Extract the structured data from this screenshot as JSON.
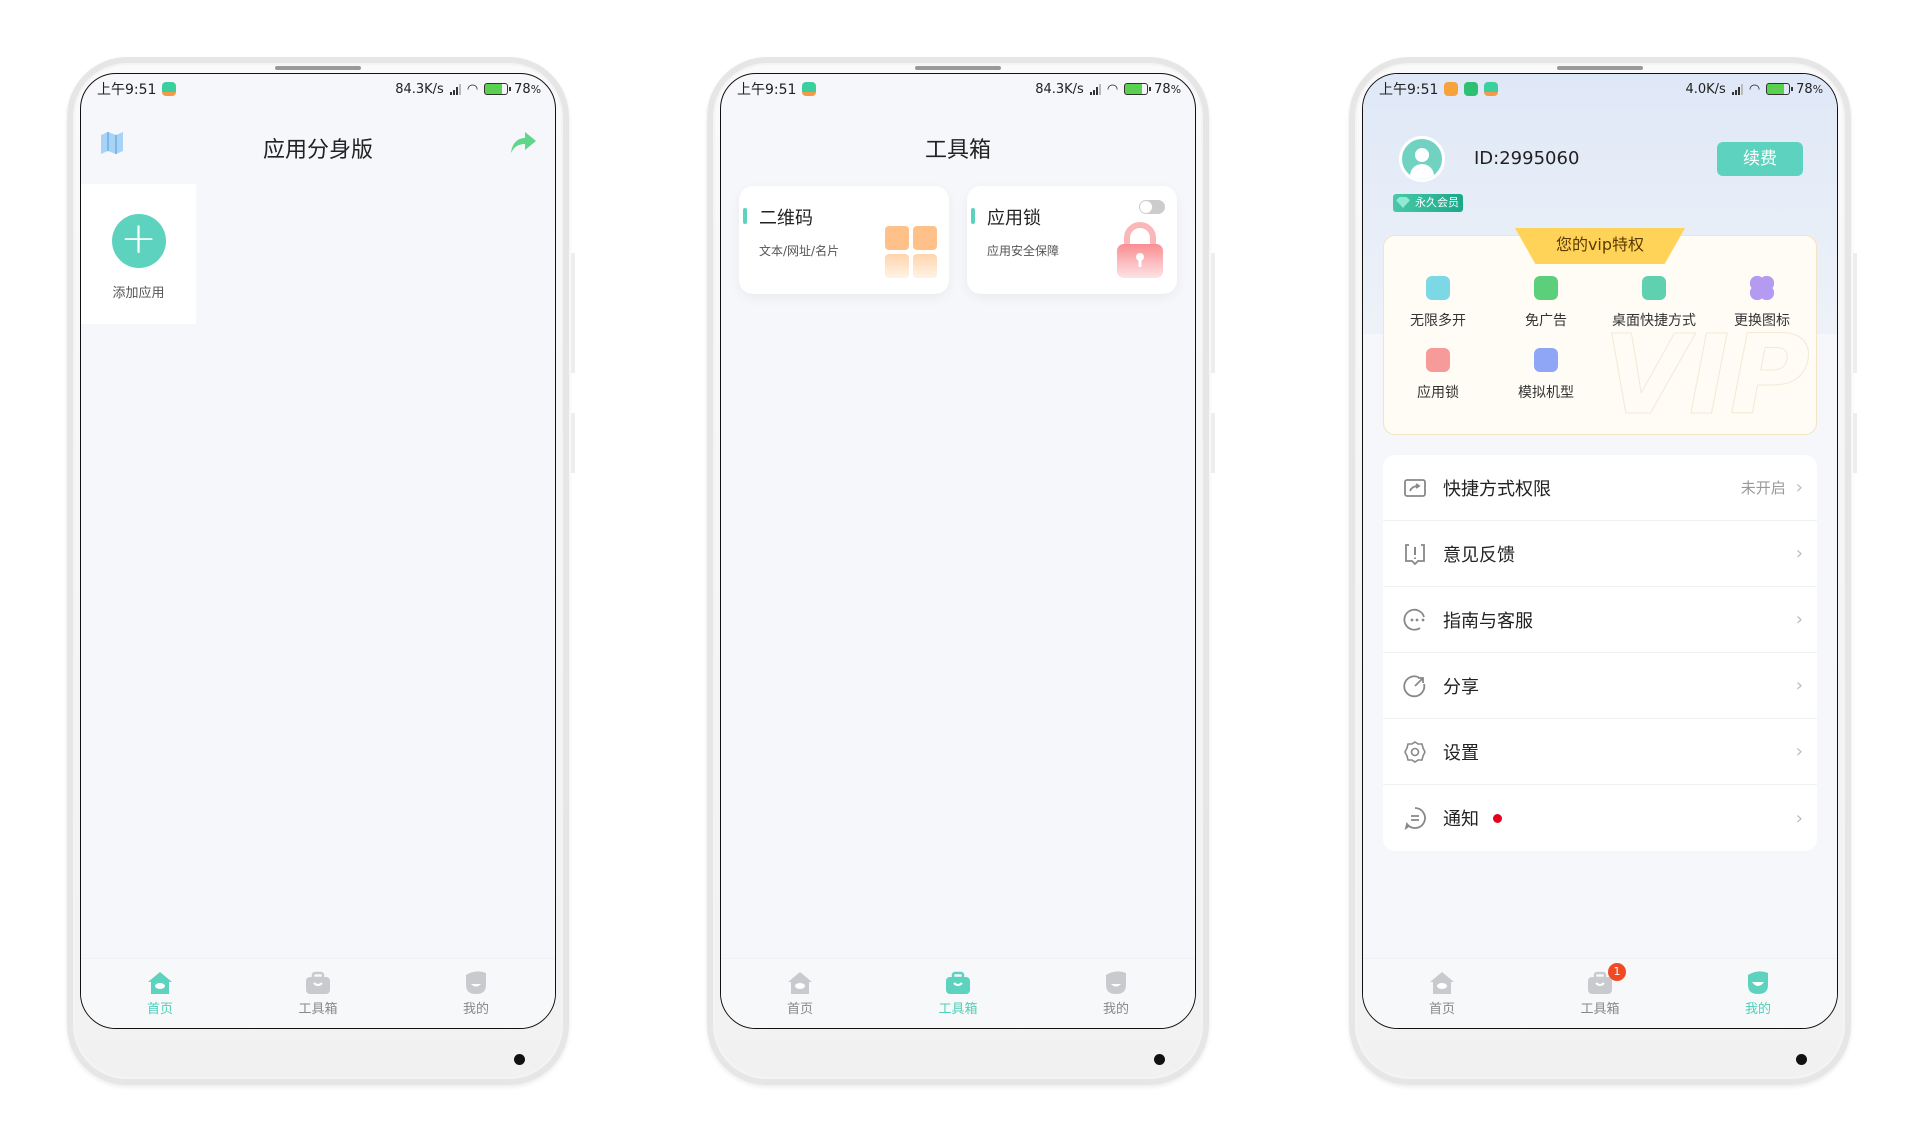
{
  "status_bar": {
    "time": "上午9:51",
    "battery": "78",
    "battery_unit": "%",
    "speed_phone1": "84.3K/s",
    "speed_phone2": "84.3K/s",
    "speed_phone3": "4.0K/s"
  },
  "home_screen": {
    "title": "应用分身版",
    "left_icon": "map-guide-icon",
    "right_icon": "share-arrow-icon",
    "add_app_label": "添加应用"
  },
  "toolbox_screen": {
    "title": "工具箱",
    "cards": [
      {
        "title": "二维码",
        "subtitle": "文本/网址/名片",
        "icon": "qr-code-icon"
      },
      {
        "title": "应用锁",
        "subtitle": "应用安全保障",
        "icon": "lock-icon",
        "toggle_on": false
      }
    ]
  },
  "me_screen": {
    "user_id": "ID:2995060",
    "renew_label": "续费",
    "member_badge": "永久会员",
    "vip_title": "您的vip特权",
    "vip_watermark": "VIP",
    "vip_perks": [
      {
        "label": "无限多开",
        "icon": "multi-open-icon",
        "color": "#7dd8e6"
      },
      {
        "label": "免广告",
        "icon": "no-ads-icon",
        "color": "#5ccf7a"
      },
      {
        "label": "桌面快捷方式",
        "icon": "shortcut-icon",
        "color": "#5fd1b0"
      },
      {
        "label": "更换图标",
        "icon": "clover-icon",
        "color": "#b49af0"
      },
      {
        "label": "应用锁",
        "icon": "lock-icon",
        "color": "#f79a9a"
      },
      {
        "label": "模拟机型",
        "icon": "device-icon",
        "color": "#8ea6f5"
      }
    ],
    "menu": [
      {
        "label": "快捷方式权限",
        "icon": "shortcut-permission-icon",
        "status": "未开启"
      },
      {
        "label": "意见反馈",
        "icon": "feedback-icon",
        "status": ""
      },
      {
        "label": "指南与客服",
        "icon": "customer-service-icon",
        "status": ""
      },
      {
        "label": "分享",
        "icon": "share-icon",
        "status": ""
      },
      {
        "label": "设置",
        "icon": "settings-icon",
        "status": ""
      },
      {
        "label": "通知",
        "icon": "notification-icon",
        "status": "",
        "has_dot": true
      }
    ]
  },
  "bottom_nav": {
    "items": [
      {
        "label": "首页",
        "icon": "home-icon"
      },
      {
        "label": "工具箱",
        "icon": "toolbox-icon"
      },
      {
        "label": "我的",
        "icon": "profile-icon"
      }
    ],
    "toolbox_badge": "1"
  },
  "colors": {
    "accent": "#5dd3bf",
    "inactive": "#c8cacd",
    "badge_red": "#f04a24",
    "notify_dot": "#e6001e"
  }
}
